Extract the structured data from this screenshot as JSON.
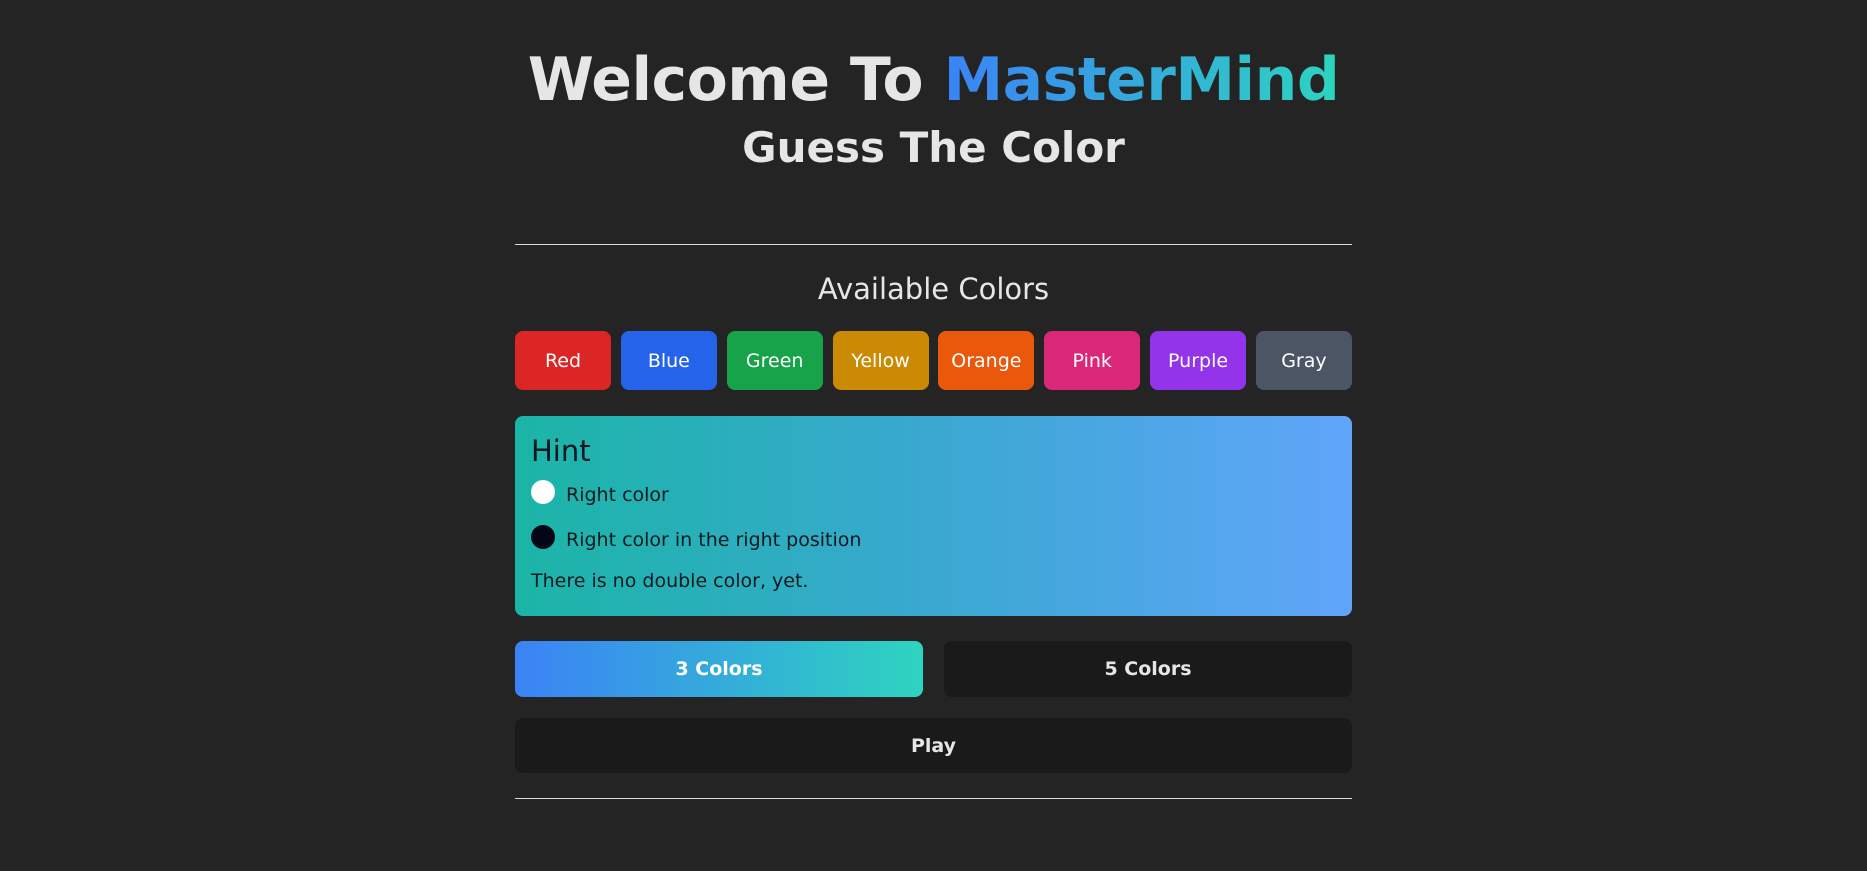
{
  "header": {
    "title_prefix": "Welcome To ",
    "title_brand": "MasterMind",
    "subtitle": "Guess The Color"
  },
  "available_colors": {
    "title": "Available Colors",
    "items": [
      {
        "label": "Red",
        "color": "#dc2626"
      },
      {
        "label": "Blue",
        "color": "#2563eb"
      },
      {
        "label": "Green",
        "color": "#16a34a"
      },
      {
        "label": "Yellow",
        "color": "#ca8a04"
      },
      {
        "label": "Orange",
        "color": "#ea580c"
      },
      {
        "label": "Pink",
        "color": "#db2777"
      },
      {
        "label": "Purple",
        "color": "#9333ea"
      },
      {
        "label": "Gray",
        "color": "#4b5563"
      }
    ]
  },
  "hint": {
    "title": "Hint",
    "right_color": "Right color",
    "right_position": "Right color in the right position",
    "note": "There is no double color, yet."
  },
  "modes": {
    "three": "3 Colors",
    "five": "5 Colors",
    "selected": "3 Colors"
  },
  "play_label": "Play",
  "colors": {
    "background": "#242424",
    "accent_start": "#3b82f6",
    "accent_end": "#2dd4bf",
    "button_dark": "#1a1a1a"
  }
}
